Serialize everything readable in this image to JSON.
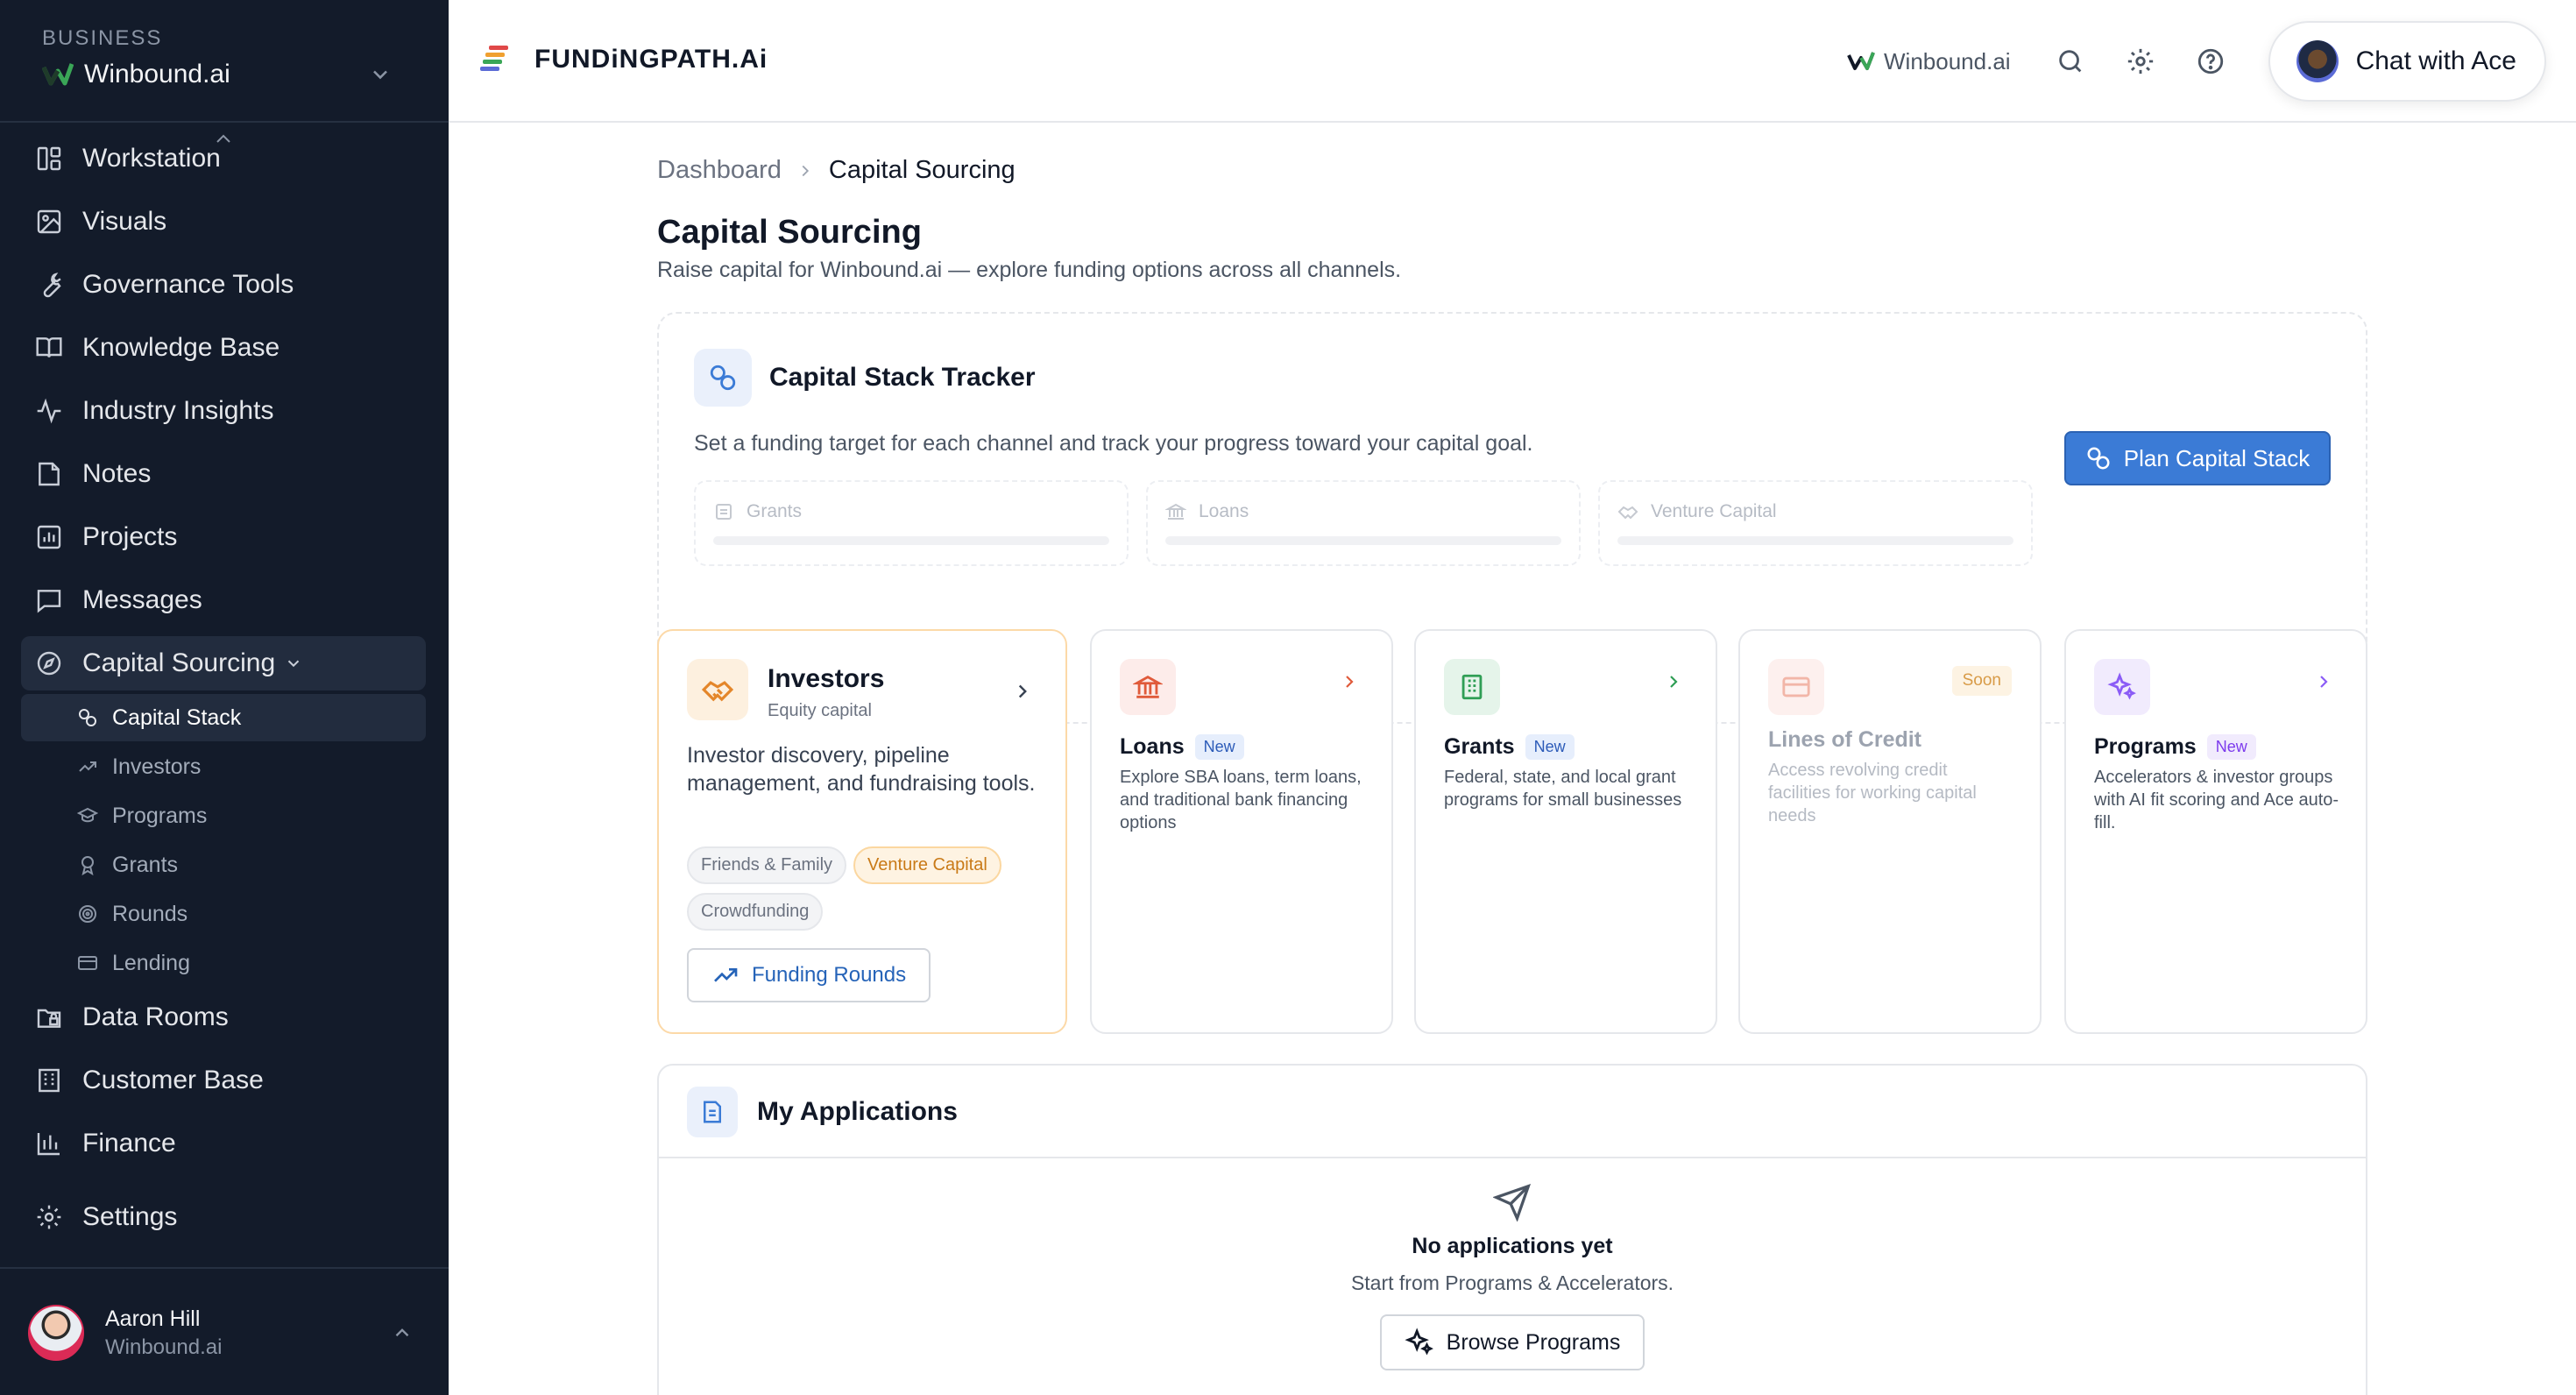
{
  "sidebar": {
    "business_label": "Business",
    "business_name": "Winbound.ai",
    "nav": [
      {
        "label": "Workstation",
        "icon": "layout-icon"
      },
      {
        "label": "Visuals",
        "icon": "image-icon"
      },
      {
        "label": "Governance Tools",
        "icon": "wrench-icon"
      },
      {
        "label": "Knowledge Base",
        "icon": "book-icon"
      },
      {
        "label": "Industry Insights",
        "icon": "pulse-icon"
      },
      {
        "label": "Notes",
        "icon": "note-icon"
      },
      {
        "label": "Projects",
        "icon": "chart-icon"
      },
      {
        "label": "Messages",
        "icon": "message-icon"
      },
      {
        "label": "Capital Sourcing",
        "icon": "compass-icon"
      }
    ],
    "sub_nav": [
      {
        "label": "Capital Stack"
      },
      {
        "label": "Investors"
      },
      {
        "label": "Programs"
      },
      {
        "label": "Grants"
      },
      {
        "label": "Rounds"
      },
      {
        "label": "Lending"
      }
    ],
    "nav_after": [
      {
        "label": "Data Rooms"
      },
      {
        "label": "Customer Base"
      },
      {
        "label": "Finance"
      }
    ],
    "settings_label": "Settings",
    "user": {
      "name": "Aaron Hill",
      "business": "Winbound.ai"
    }
  },
  "header": {
    "brand": "FUNDiNGPATH.Ai",
    "business": "Winbound.ai",
    "chat_label": "Chat with Ace"
  },
  "breadcrumb": {
    "root": "Dashboard",
    "current": "Capital Sourcing"
  },
  "page": {
    "title": "Capital Sourcing",
    "subtitle": "Raise capital for Winbound.ai — explore funding options across all channels."
  },
  "tracker": {
    "title": "Capital Stack Tracker",
    "description": "Set a funding target for each channel and track your progress toward your capital goal.",
    "button": "Plan Capital Stack",
    "channels": [
      {
        "label": "Grants",
        "progress": 0
      },
      {
        "label": "Loans",
        "progress": 0
      },
      {
        "label": "Venture Capital",
        "progress": 0
      }
    ]
  },
  "investors_card": {
    "title": "Investors",
    "subtitle": "Equity capital",
    "description": "Investor discovery, pipeline management, and fundraising tools.",
    "tags": [
      "Friends & Family",
      "Venture Capital",
      "Crowdfunding"
    ],
    "button": "Funding Rounds"
  },
  "cards": [
    {
      "title": "Loans",
      "badge": "New",
      "description": "Explore SBA loans, term loans, and traditional bank financing options"
    },
    {
      "title": "Grants",
      "badge": "New",
      "description": "Federal, state, and local grant programs for small businesses"
    },
    {
      "title": "Lines of Credit",
      "badge": "Soon",
      "description": "Access revolving credit facilities for working capital needs"
    },
    {
      "title": "Programs",
      "badge": "New",
      "description": "Accelerators & investor groups with AI fit scoring and Ace auto-fill."
    }
  ],
  "applications": {
    "title": "My Applications",
    "empty_title": "No applications yet",
    "empty_sub": "Start from Programs & Accelerators.",
    "button": "Browse Programs"
  },
  "colors": {
    "sidebar_bg": "#131b2a",
    "accent_blue": "#3b7bd6",
    "investor_orange": "#e4862a",
    "loans_red": "#e05a3a",
    "grants_green": "#2f9e55",
    "programs_purple": "#8b5cf6"
  }
}
